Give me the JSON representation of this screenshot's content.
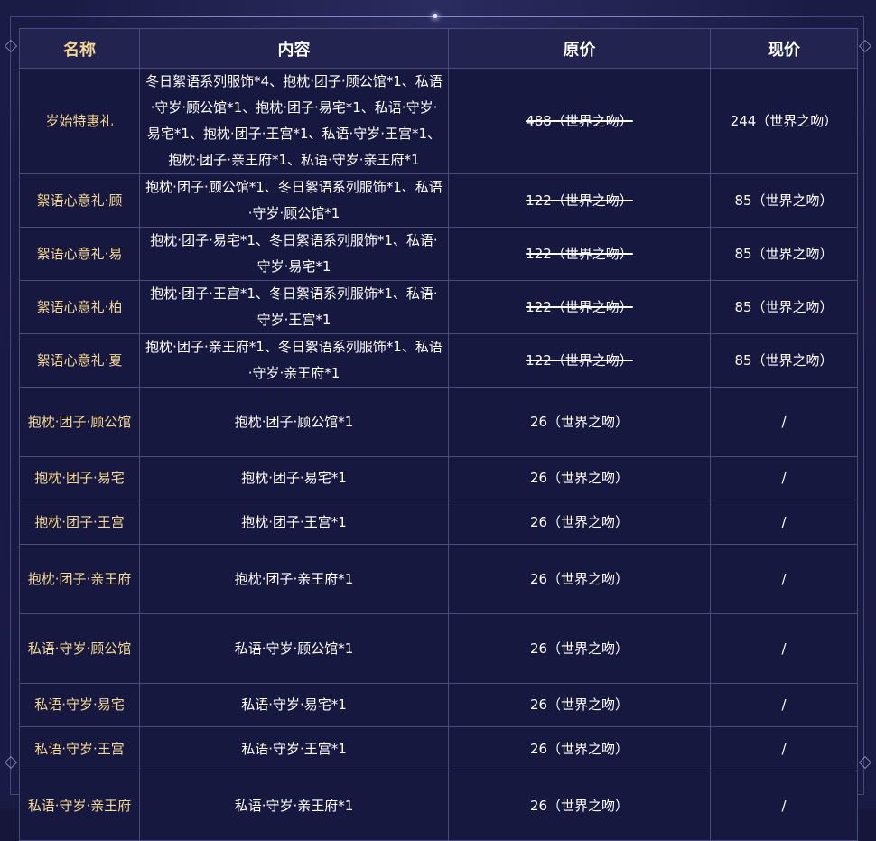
{
  "table": {
    "headers": [
      "名称",
      "内容",
      "原价",
      "现价"
    ],
    "rows": [
      {
        "name": "岁始特惠礼",
        "content": "冬日絮语系列服饰*4、抱枕·团子·顾公馆*1、私语·守岁·顾公馆*1、抱枕·团子·易宅*1、私语·守岁·易宅*1、抱枕·团子·王宫*1、私语·守岁·王宫*1、抱枕·团子·亲王府*1、私语·守岁·亲王府*1",
        "original_price": "488（世界之吻）",
        "original_struck": true,
        "current_price": "244（世界之吻）"
      },
      {
        "name": "絮语心意礼·顾",
        "content": "抱枕·团子·顾公馆*1、冬日絮语系列服饰*1、私语·守岁·顾公馆*1",
        "original_price": "122（世界之吻）",
        "original_struck": true,
        "current_price": "85（世界之吻）"
      },
      {
        "name": "絮语心意礼·易",
        "content": "抱枕·团子·易宅*1、冬日絮语系列服饰*1、私语·守岁·易宅*1",
        "original_price": "122（世界之吻）",
        "original_struck": true,
        "current_price": "85（世界之吻）"
      },
      {
        "name": "絮语心意礼·柏",
        "content": "抱枕·团子·王宫*1、冬日絮语系列服饰*1、私语·守岁·王宫*1",
        "original_price": "122（世界之吻）",
        "original_struck": true,
        "current_price": "85（世界之吻）"
      },
      {
        "name": "絮语心意礼·夏",
        "content": "抱枕·团子·亲王府*1、冬日絮语系列服饰*1、私语·守岁·亲王府*1",
        "original_price": "122（世界之吻）",
        "original_struck": true,
        "current_price": "85（世界之吻）"
      },
      {
        "name": "抱枕·团子·顾公馆",
        "content": "抱枕·团子·顾公馆*1",
        "original_price": "26（世界之吻）",
        "original_struck": false,
        "current_price": "/"
      },
      {
        "name": "抱枕·团子·易宅",
        "content": "抱枕·团子·易宅*1",
        "original_price": "26（世界之吻）",
        "original_struck": false,
        "current_price": "/"
      },
      {
        "name": "抱枕·团子·王宫",
        "content": "抱枕·团子·王宫*1",
        "original_price": "26（世界之吻）",
        "original_struck": false,
        "current_price": "/"
      },
      {
        "name": "抱枕·团子·亲王府",
        "content": "抱枕·团子·亲王府*1",
        "original_price": "26（世界之吻）",
        "original_struck": false,
        "current_price": "/"
      },
      {
        "name": "私语·守岁·顾公馆",
        "content": "私语·守岁·顾公馆*1",
        "original_price": "26（世界之吻）",
        "original_struck": false,
        "current_price": "/"
      },
      {
        "name": "私语·守岁·易宅",
        "content": "私语·守岁·易宅*1",
        "original_price": "26（世界之吻）",
        "original_struck": false,
        "current_price": "/"
      },
      {
        "name": "私语·守岁·王宫",
        "content": "私语·守岁·王宫*1",
        "original_price": "26（世界之吻）",
        "original_struck": false,
        "current_price": "/"
      },
      {
        "name": "私语·守岁·亲王府",
        "content": "私语·守岁·亲王府*1",
        "original_price": "26（世界之吻）",
        "original_struck": false,
        "current_price": "/"
      }
    ]
  },
  "colors": {
    "name_text": "#f3d792",
    "body_text": "#ffffff",
    "background": "#17183f",
    "border": "#4a4c7c"
  }
}
